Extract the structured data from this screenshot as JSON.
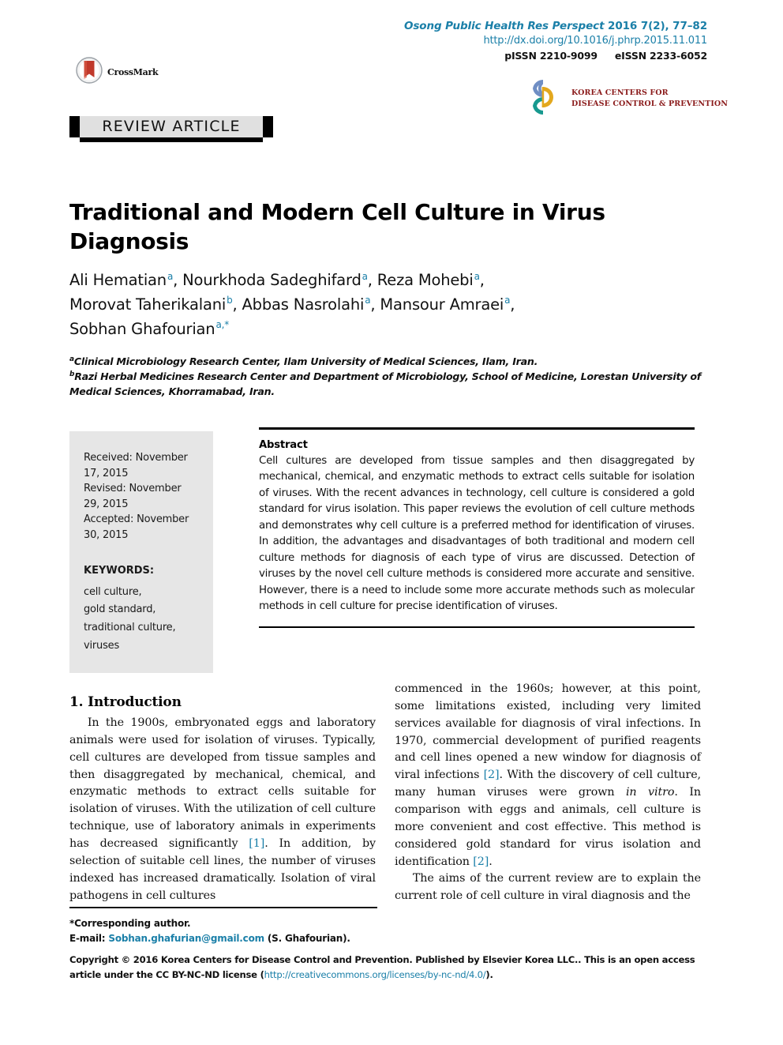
{
  "header": {
    "journal_citation_italic": "Osong Public Health Res Perspect",
    "journal_citation_plain": "2016 7(2), 77–82",
    "doi_url": "http://dx.doi.org/10.1016/j.phrp.2015.11.011",
    "pissn": "pISSN 2210-9099",
    "eissn": "eISSN 2233-6052",
    "crossmark_label": "CrossMark",
    "kcdc_line1": "KOREA CENTERS FOR",
    "kcdc_line2": "DISEASE CONTROL & PREVENTION",
    "article_type_banner": "REVIEW ARTICLE"
  },
  "article": {
    "title": "Traditional and Modern Cell Culture in Virus Diagnosis",
    "authors_line1": "Ali Hematian",
    "authors": [
      {
        "name": "Ali Hematian",
        "sup": "a"
      },
      {
        "name": "Nourkhoda Sadeghifard",
        "sup": "a"
      },
      {
        "name": "Reza Mohebi",
        "sup": "a"
      },
      {
        "name": "Morovat Taherikalani",
        "sup": "b"
      },
      {
        "name": "Abbas Nasrolahi",
        "sup": "a"
      },
      {
        "name": "Mansour Amraei",
        "sup": "a"
      },
      {
        "name": "Sobhan Ghafourian",
        "sup": "a,*"
      }
    ],
    "affiliation_a_sup": "a",
    "affiliation_a": "Clinical Microbiology Research Center, Ilam University of Medical Sciences, Ilam, Iran.",
    "affiliation_b_sup": "b",
    "affiliation_b": "Razi Herbal Medicines Research Center and Department of Microbiology, School of Medicine, Lorestan University of Medical Sciences, Khorramabad, Iran."
  },
  "sidebar": {
    "dates": "Received: November 17, 2015\nRevised: November 29, 2015\nAccepted: November 30, 2015",
    "keywords_heading": "KEYWORDS:",
    "keywords": "cell culture,\ngold standard,\ntraditional culture,\nviruses"
  },
  "abstract": {
    "heading": "Abstract",
    "text": "Cell cultures are developed from tissue samples and then disaggregated by mechanical, chemical, and enzymatic methods to extract cells suitable for isolation of viruses. With the recent advances in technology, cell culture is considered a gold standard for virus isolation. This paper reviews the evolution of cell culture methods and demonstrates why cell culture is a preferred method for identification of viruses. In addition, the advantages and disadvantages of both traditional and modern cell culture methods for diagnosis of each type of virus are discussed. Detection of viruses by the novel cell culture methods is considered more accurate and sensitive. However, there is a need to include some more accurate methods such as molecular methods in cell culture for precise identification of viruses."
  },
  "body": {
    "section_heading": "1. Introduction",
    "left_para1_a": "In the 1900s, embryonated eggs and laboratory animals were used for isolation of viruses. Typically, cell cultures are developed from tissue samples and then disaggregated by mechanical, chemical, and enzymatic methods to extract cells suitable for isolation of viruses. With the utilization of cell culture technique, use of laboratory animals in experiments has decreased significantly ",
    "left_cite1": "[1]",
    "left_para1_b": ". In addition, by selection of suitable cell lines, the number of viruses indexed has increased dramatically. Isolation of viral pathogens in cell cultures",
    "right_para1_a": "commenced in the 1960s; however, at this point, some limitations existed, including very limited services available for diagnosis of viral infections. In 1970, commercial development of purified reagents and cell lines opened a new window for diagnosis of viral infections ",
    "right_cite1": "[2]",
    "right_para1_b": ". With the discovery of cell culture, many human viruses were grown ",
    "right_italic1": "in vitro",
    "right_para1_c": ". In comparison with eggs and animals, cell culture is more convenient and cost effective. This method is considered gold standard for virus isolation and identification ",
    "right_cite2": "[2]",
    "right_para1_d": ".",
    "right_para2": "The aims of the current review are to explain the current role of cell culture in viral diagnosis and the"
  },
  "footer": {
    "corresponding_note": "*Corresponding author.",
    "email_prefix": "E-mail: ",
    "email": "Sobhan.ghafurian@gmail.com",
    "email_suffix": " (S. Ghafourian).",
    "copyright_a": "Copyright © 2016 Korea Centers for Disease Control and Prevention. Published by Elsevier Korea LLC.. This is an open access article under the CC BY-NC-ND license (",
    "copyright_link": "http://creativecommons.org/licenses/by-nc-nd/4.0/",
    "copyright_b": ")."
  },
  "colors": {
    "accent_teal": "#1a7fa8",
    "kcdc_blue": "#6f8ec4",
    "kcdc_gold": "#e3a81e",
    "kcdc_teal": "#17998f",
    "crossmark_red": "#c0392b",
    "sidebar_bg": "#e6e6e6",
    "banner_bg": "#e0e0e0"
  }
}
